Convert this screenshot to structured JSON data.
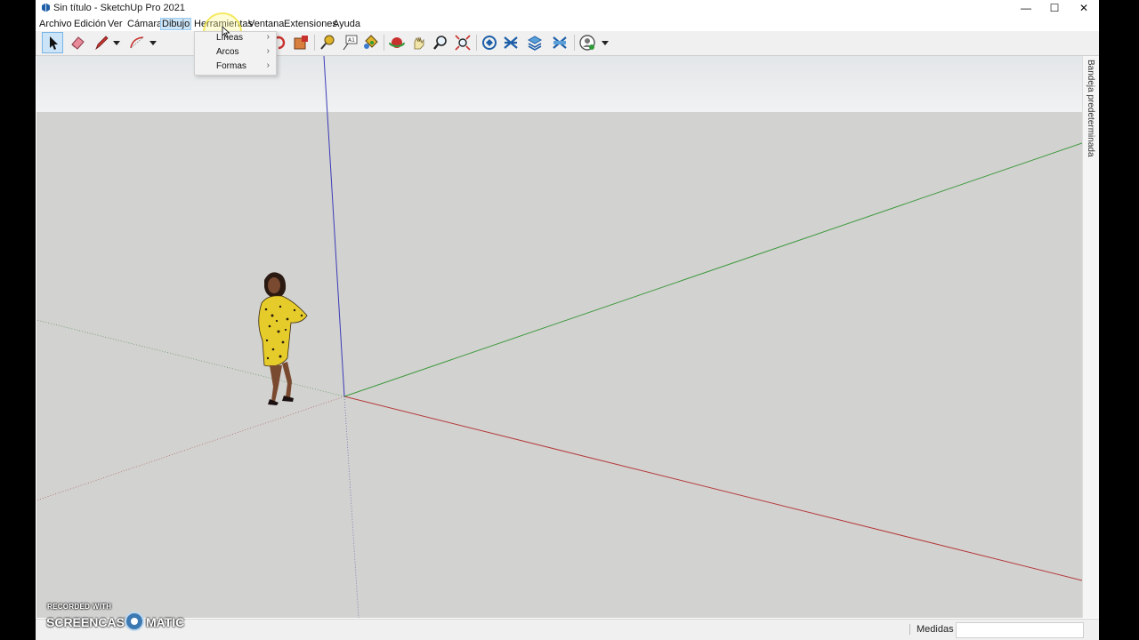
{
  "window": {
    "title": "Sin título - SketchUp Pro 2021",
    "minimize_glyph": "—",
    "maximize_glyph": "☐",
    "close_glyph": "✕"
  },
  "menubar": {
    "items": [
      "Archivo",
      "Edición",
      "Ver",
      "Cámara",
      "Dibujo",
      "Herramientas",
      "Ventana",
      "Extensiones",
      "Ayuda"
    ],
    "active": "Dibujo"
  },
  "toolbar": {
    "tools": [
      "select-icon",
      "eraser-icon",
      "pencil-icon",
      "arc-icon",
      "move-icon",
      "rotate-icon",
      "scale-icon",
      "tape-measure-icon",
      "text-icon",
      "paint-bucket-icon",
      "orbit-icon",
      "pan-icon",
      "zoom-icon",
      "zoom-extents-icon",
      "warehouse-icon",
      "extension-warehouse-icon",
      "layout-icon",
      "extension-manager-icon",
      "profile-icon"
    ]
  },
  "dropdown": {
    "items": [
      {
        "label": "Líneas",
        "arrow": "›"
      },
      {
        "label": "Arcos",
        "arrow": "›"
      },
      {
        "label": "Formas",
        "arrow": "›"
      }
    ]
  },
  "tray": {
    "label": "Bandeja predeterminada"
  },
  "statusbar": {
    "measurements_label": "Medidas",
    "measurements_value": ""
  },
  "watermark": {
    "top": "RECORDED WITH",
    "left": "SCREENCAST",
    "right": "MATIC"
  },
  "colors": {
    "red_axis": "#b53a3a",
    "green_axis": "#3f9a3f",
    "blue_axis": "#3b3bb8",
    "ground": "#d2d2d0",
    "sky": "#e9ebec",
    "figure_dress": "#e6cc2a"
  }
}
